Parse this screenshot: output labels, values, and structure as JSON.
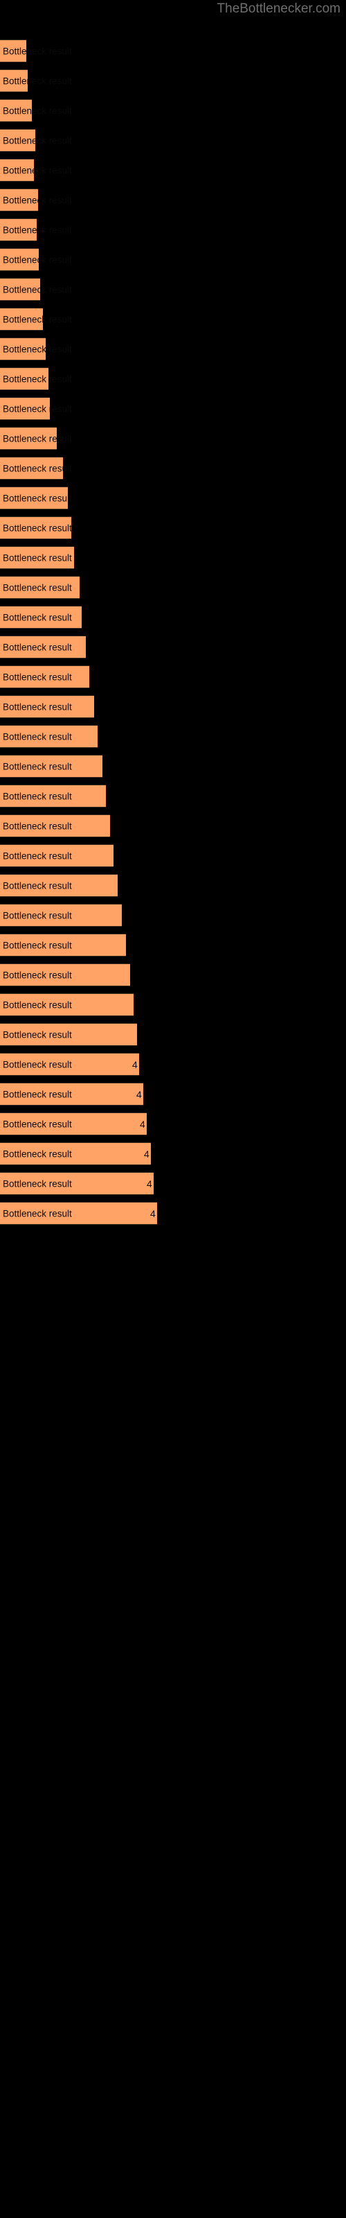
{
  "chart": {
    "title": "TheBottlenecker.com",
    "background_color": "#000000",
    "title_color": "#6e6e6e",
    "bar_color": "#ffa366",
    "bar_edge_color": "#3a2a1c",
    "bar_label_color": "#0a0a0a"
  },
  "chart_data": {
    "type": "bar",
    "orientation": "horizontal",
    "title": "TheBottlenecker.com",
    "xlabel": "",
    "ylabel": "",
    "grid": false,
    "legend": null,
    "xlim": [
      0,
      500
    ],
    "bar_label_text": "Bottleneck result",
    "categories": [
      "Bottleneck result",
      "Bottleneck result",
      "Bottleneck result",
      "Bottleneck result",
      "Bottleneck result",
      "Bottleneck result",
      "Bottleneck result",
      "Bottleneck result",
      "Bottleneck result",
      "Bottleneck result",
      "Bottleneck result",
      "Bottleneck result",
      "Bottleneck result",
      "Bottleneck result",
      "Bottleneck result",
      "Bottleneck result",
      "Bottleneck result",
      "Bottleneck result",
      "Bottleneck result",
      "Bottleneck result",
      "Bottleneck result",
      "Bottleneck result",
      "Bottleneck result",
      "Bottleneck result",
      "Bottleneck result",
      "Bottleneck result",
      "Bottleneck result",
      "Bottleneck result",
      "Bottleneck result",
      "Bottleneck result",
      "Bottleneck result",
      "Bottleneck result",
      "Bottleneck result",
      "Bottleneck result",
      "Bottleneck result",
      "Bottleneck result",
      "Bottleneck result",
      "Bottleneck result",
      "Bottleneck result",
      "Bottleneck result"
    ],
    "values": [
      38,
      40,
      46,
      51,
      49,
      55,
      53,
      56,
      58,
      62,
      66,
      70,
      72,
      82,
      91,
      98,
      103,
      107,
      115,
      118,
      124,
      129,
      136,
      141,
      148,
      153,
      159,
      164,
      170,
      176,
      182,
      188,
      193,
      198,
      201,
      207,
      212,
      218,
      222,
      227
    ],
    "value_labels": [
      "",
      "",
      "",
      "",
      "",
      "",
      "",
      "",
      "",
      "",
      "",
      "",
      "",
      "",
      "",
      "",
      "",
      "",
      "",
      "",
      "",
      "",
      "",
      "",
      "",
      "",
      "",
      "",
      "",
      "",
      "",
      "",
      "",
      "",
      "4",
      "4",
      "4",
      "4",
      "4",
      "4"
    ],
    "bar_tops": [
      57,
      100,
      143,
      186,
      229,
      272,
      315,
      358,
      401,
      444,
      487,
      530,
      573,
      616,
      659,
      702,
      745,
      788,
      831,
      874,
      917,
      960,
      1003,
      1046,
      1089,
      1132,
      1175,
      1218,
      1261,
      1304,
      1347,
      1390,
      1433,
      1476,
      1519,
      1562,
      1605,
      1648,
      1691,
      1734
    ]
  }
}
